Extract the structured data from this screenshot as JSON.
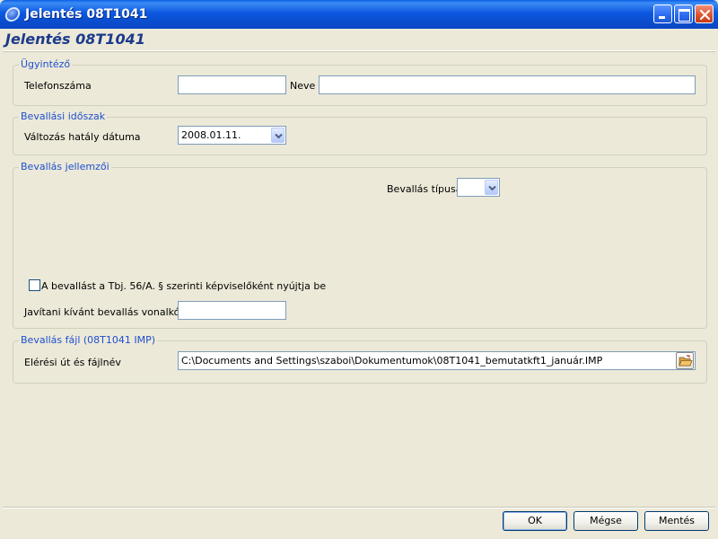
{
  "window": {
    "title": "Jelentés 08T1041",
    "heading": "Jelentés 08T1041"
  },
  "ugyintezo": {
    "legend": "Ügyintéző",
    "phone_label": "Telefonszáma",
    "phone_value": "",
    "name_label": "Neve",
    "name_value": ""
  },
  "idoszak": {
    "legend": "Bevallási időszak",
    "date_label": "Változás hatály dátuma",
    "date_value": "2008.01.11."
  },
  "jellemzoi": {
    "legend": "Bevallás jellemzői",
    "type_label": "Bevallás típusa",
    "type_value": "",
    "checkbox_label": "A bevallást a Tbj. 56/A. § szerinti képviselőként nyújtja be",
    "checkbox_checked": false,
    "barcode_label": "Javítani kívánt bevallás vonalkódja",
    "barcode_value": ""
  },
  "fajl": {
    "legend": "Bevallás fájl (08T1041 IMP)",
    "path_label": "Elérési út és fájlnév",
    "path_value": "C:\\Documents and Settings\\szaboi\\Dokumentumok\\08T1041_bemutatkft1_január.IMP"
  },
  "buttons": {
    "ok": "OK",
    "cancel": "Mégse",
    "save": "Mentés"
  },
  "icons": {
    "app": "app-logo-icon",
    "minimize": "minimize-icon",
    "maximize": "maximize-icon",
    "close": "close-icon",
    "dropdown": "chevron-down-icon",
    "browse": "open-folder-icon"
  }
}
